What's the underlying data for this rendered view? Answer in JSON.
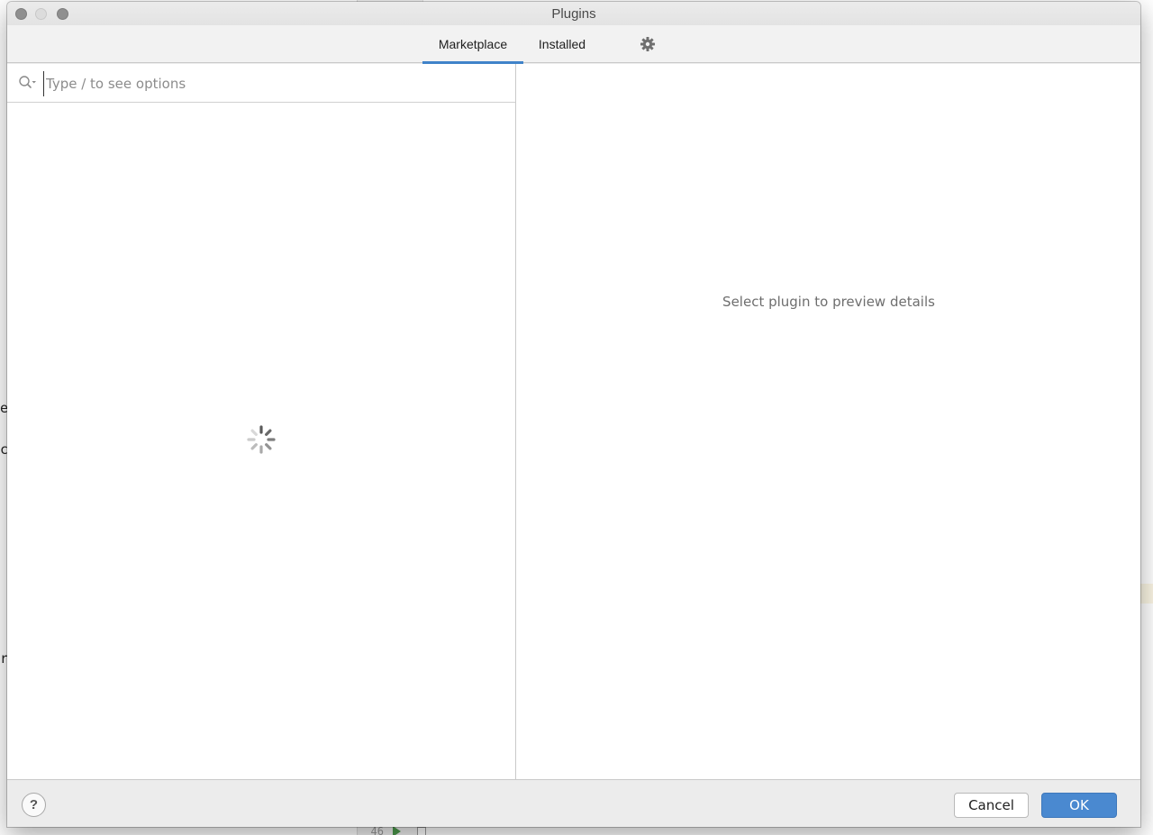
{
  "window": {
    "title": "Plugins"
  },
  "tabs": [
    {
      "label": "Marketplace",
      "selected": true
    },
    {
      "label": "Installed",
      "selected": false
    }
  ],
  "settings": {
    "icon": "gear-icon"
  },
  "search": {
    "placeholder": "Type / to see options",
    "value": "",
    "icon": "search-icon"
  },
  "plugin_list": {
    "state": "loading",
    "icon": "spinner-icon"
  },
  "details": {
    "hint": "Select plugin to preview details"
  },
  "footer": {
    "help_label": "?",
    "cancel_label": "Cancel",
    "ok_label": "OK"
  },
  "colors": {
    "accent": "#4083c9",
    "ok_button": "#4a89d0"
  }
}
